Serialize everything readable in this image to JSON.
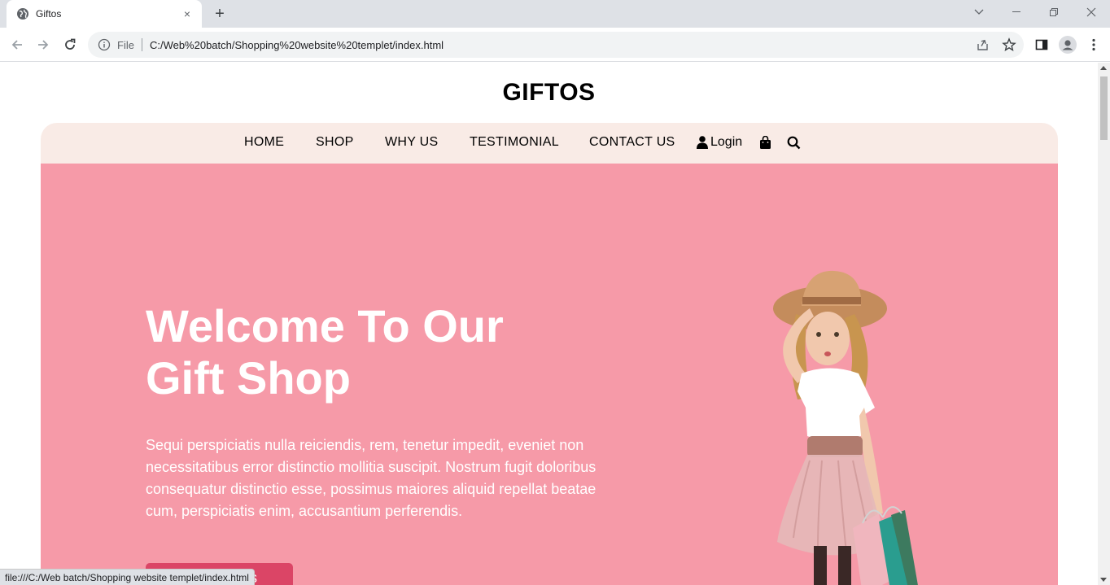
{
  "browser": {
    "tab_title": "Giftos",
    "new_tab": "+",
    "tab_close": "×",
    "url_scheme": "File",
    "url": "C:/Web%20batch/Shopping%20website%20templet/index.html",
    "status_url": "file:///C:/Web batch/Shopping website templet/index.html"
  },
  "site": {
    "brand": "GIFTOS",
    "nav": {
      "home": "HOME",
      "shop": "SHOP",
      "why_us": "WHY US",
      "testimonial": "TESTIMONIAL",
      "contact": "CONTACT US",
      "login": "Login"
    },
    "hero": {
      "title_line1": "Welcome To Our",
      "title_line2": "Gift Shop",
      "text": "Sequi perspiciatis nulla reiciendis, rem, tenetur impedit, eveniet non necessitatibus error distinctio mollitia suscipit. Nostrum fugit doloribus consequatur distinctio esse, possimus maiores aliquid repellat beatae cum, perspiciatis enim, accusantium perferendis.",
      "button": "Contact Us"
    }
  },
  "colors": {
    "navbar_bg": "#f9ebe6",
    "hero_bg": "#f69aa8",
    "button_bg": "#db4566"
  },
  "icons": [
    "globe-icon",
    "back-icon",
    "forward-icon",
    "reload-icon",
    "info-icon",
    "share-icon",
    "star-icon",
    "sidepanel-icon",
    "profile-icon",
    "menu-icon",
    "user-icon",
    "bag-icon",
    "search-icon"
  ]
}
